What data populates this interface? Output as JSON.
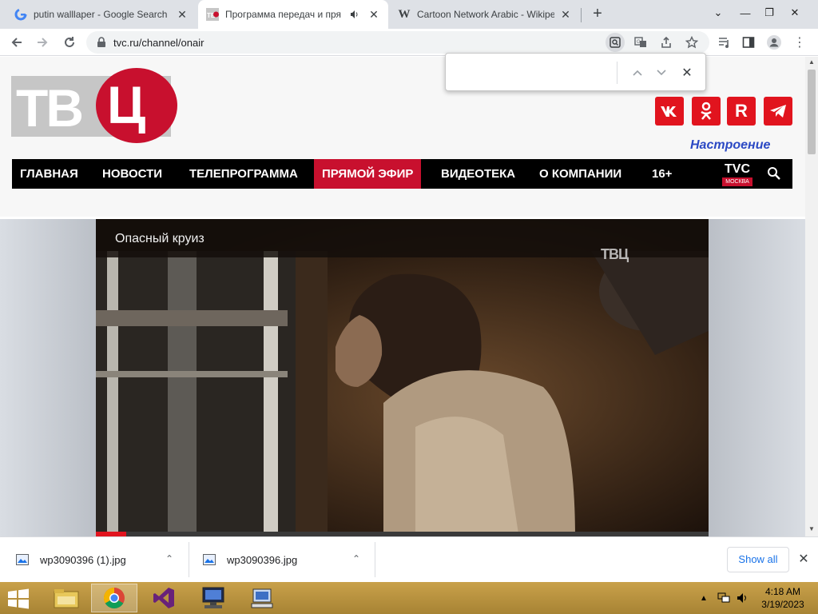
{
  "browser": {
    "tabs": [
      {
        "title": "putin walllaper - Google Search",
        "favicon": "google-icon"
      },
      {
        "title": "Программа передач и пря",
        "favicon": "tvc-favicon",
        "audio": true
      },
      {
        "title": "Cartoon Network Arabic - Wikipe",
        "favicon": "wikipedia-icon"
      }
    ],
    "url": "tvc.ru/channel/onair"
  },
  "site": {
    "logo_text": "ТВ",
    "logo_letter": "Ц",
    "social": [
      "vk-icon",
      "ok-icon",
      "rutube-icon",
      "telegram-icon"
    ],
    "nastroenie": "Настроение",
    "nav": [
      {
        "label": "ГЛАВНАЯ"
      },
      {
        "label": "НОВОСТИ"
      },
      {
        "label": "ТЕЛЕПРОГРАММА"
      },
      {
        "label": "ПРЯМОЙ ЭФИР",
        "active": true
      },
      {
        "label": "ВИДЕОТЕКА"
      },
      {
        "label": "О КОМПАНИИ"
      },
      {
        "label": "16+"
      }
    ],
    "tvc_logo": "TVC",
    "tvc_city": "МОСКВА"
  },
  "video": {
    "title": "Опасный круиз",
    "watermark": "ТВЦ",
    "progress": 0.05
  },
  "find_bar": {
    "value": ""
  },
  "downloads": {
    "items": [
      {
        "name": "wp3090396 (1).jpg"
      },
      {
        "name": "wp3090396.jpg"
      }
    ],
    "show_all": "Show all"
  },
  "taskbar": {
    "apps": [
      "file-explorer-icon",
      "chrome-icon",
      "visual-studio-icon",
      "computer-icon",
      "network-icon"
    ],
    "time": "4:18 AM",
    "date": "3/19/2023"
  },
  "colors": {
    "brand_red": "#c8102e",
    "nav_bg": "#000000"
  }
}
